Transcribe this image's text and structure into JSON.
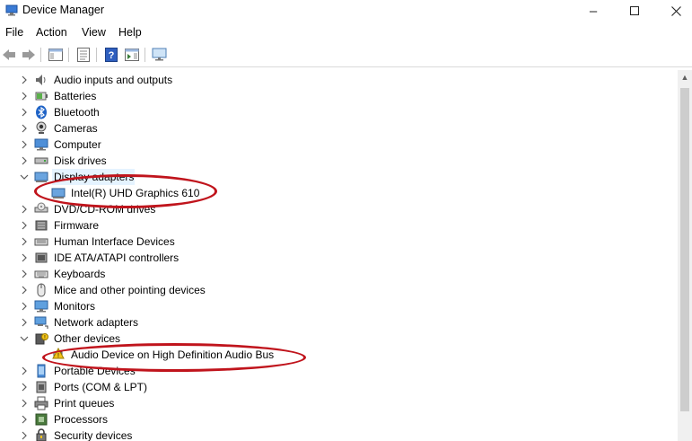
{
  "window": {
    "title": "Device Manager"
  },
  "menu": [
    "File",
    "Action",
    "View",
    "Help"
  ],
  "toolbar": {
    "buttons": [
      "back-icon",
      "forward-icon",
      "show-hide-tree-icon",
      "properties-icon",
      "help-icon",
      "action-pane-icon",
      "monitor-scan-icon"
    ]
  },
  "tree": {
    "items": [
      {
        "label": "Audio inputs and outputs",
        "icon": "speaker-icon",
        "expanded": false
      },
      {
        "label": "Batteries",
        "icon": "battery-icon",
        "expanded": false
      },
      {
        "label": "Bluetooth",
        "icon": "bluetooth-icon",
        "expanded": false
      },
      {
        "label": "Cameras",
        "icon": "camera-icon",
        "expanded": false
      },
      {
        "label": "Computer",
        "icon": "computer-icon",
        "expanded": false
      },
      {
        "label": "Disk drives",
        "icon": "disk-drive-icon",
        "expanded": false
      },
      {
        "label": "Display adapters",
        "icon": "display-adapter-icon",
        "expanded": true,
        "selected": true
      },
      {
        "label": "Intel(R) UHD Graphics 610",
        "icon": "display-adapter-icon",
        "child": true
      },
      {
        "label": "DVD/CD-ROM drives",
        "icon": "dvd-icon",
        "expanded": false
      },
      {
        "label": "Firmware",
        "icon": "firmware-icon",
        "expanded": false
      },
      {
        "label": "Human Interface Devices",
        "icon": "hid-icon",
        "expanded": false
      },
      {
        "label": "IDE ATA/ATAPI controllers",
        "icon": "ide-icon",
        "expanded": false
      },
      {
        "label": "Keyboards",
        "icon": "keyboard-icon",
        "expanded": false
      },
      {
        "label": "Mice and other pointing devices",
        "icon": "mouse-icon",
        "expanded": false
      },
      {
        "label": "Monitors",
        "icon": "monitor-icon",
        "expanded": false
      },
      {
        "label": "Network adapters",
        "icon": "network-icon",
        "expanded": false
      },
      {
        "label": "Other devices",
        "icon": "unknown-device-icon",
        "expanded": true
      },
      {
        "label": "Audio Device on High Definition Audio Bus",
        "icon": "warning-device-icon",
        "child": true
      },
      {
        "label": "Portable Devices",
        "icon": "portable-device-icon",
        "expanded": false
      },
      {
        "label": "Ports (COM & LPT)",
        "icon": "port-icon",
        "expanded": false
      },
      {
        "label": "Print queues",
        "icon": "printer-icon",
        "expanded": false
      },
      {
        "label": "Processors",
        "icon": "processor-icon",
        "expanded": false
      },
      {
        "label": "Security devices",
        "icon": "security-icon",
        "expanded": false
      }
    ]
  },
  "annotation_color": "#c0141c",
  "selection_color": "#e5f3ff"
}
